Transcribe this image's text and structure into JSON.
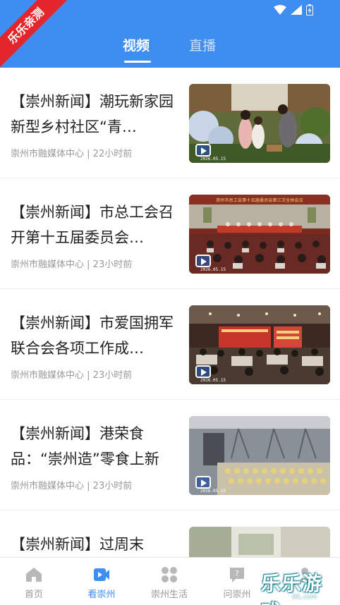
{
  "watermark": {
    "ribbon_text": "乐乐亲测",
    "brand_text": "乐乐游戏",
    "brand_url": "6lL.com"
  },
  "header": {
    "tabs": [
      {
        "label": "视频",
        "active": true
      },
      {
        "label": "直播",
        "active": false
      }
    ],
    "accent_color": "#3d8ef0"
  },
  "news": [
    {
      "title": "【崇州新闻】潮玩新家园 新型乡村社区“青…",
      "source": "崇州市融媒体中心",
      "time": "22小时前",
      "thumb_date": "2026.05.15"
    },
    {
      "title": "【崇州新闻】市总工会召开第十五届委员会…",
      "source": "崇州市融媒体中心",
      "time": "23小时前",
      "thumb_date": "2026.05.15",
      "thumb_banner": "崇州市总工会第十五届委员会第三次全体会议"
    },
    {
      "title": "【崇州新闻】市爱国拥军联合会各项工作成…",
      "source": "崇州市融媒体中心",
      "time": "23小时前",
      "thumb_date": "2026.05.15"
    },
    {
      "title": "【崇州新闻】港荣食品：“崇州造”零食上新",
      "source": "崇州市融媒体中心",
      "time": "23小时前",
      "thumb_date": "2026.05.15"
    },
    {
      "title": "【崇州新闻】过周末",
      "source": "",
      "time": "",
      "thumb_date": ""
    }
  ],
  "meta_separator": " | ",
  "bottom_nav": [
    {
      "label": "首页",
      "icon": "home-icon",
      "active": false
    },
    {
      "label": "看崇州",
      "icon": "video-play-icon",
      "active": true
    },
    {
      "label": "崇州生活",
      "icon": "grid-icon",
      "active": false
    },
    {
      "label": "问崇州",
      "icon": "question-chat-icon",
      "active": false
    },
    {
      "label": "",
      "icon": "user-icon",
      "active": false
    }
  ]
}
